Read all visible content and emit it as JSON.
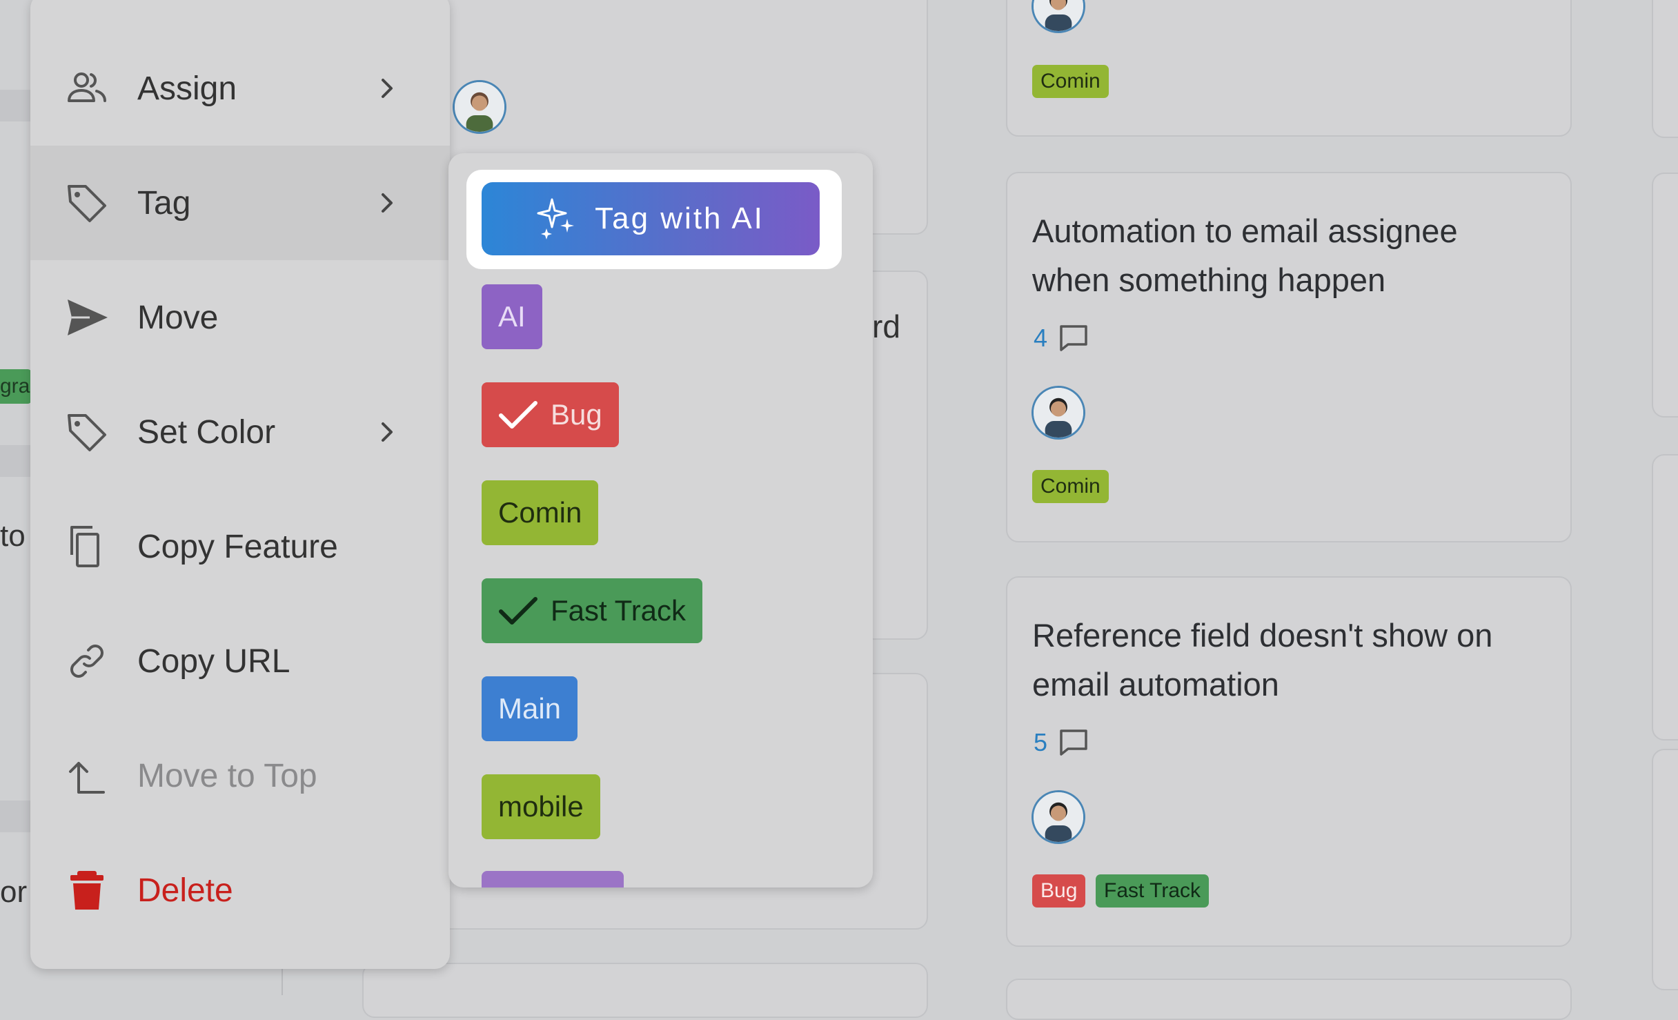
{
  "menu": {
    "items": [
      {
        "label": "Assign",
        "icon": "people-icon",
        "submenu": true
      },
      {
        "label": "Tag",
        "icon": "tag-icon",
        "submenu": true,
        "active": true
      },
      {
        "label": "Move",
        "icon": "send-icon",
        "submenu": false
      },
      {
        "label": "Set Color",
        "icon": "tag-icon",
        "submenu": true
      },
      {
        "label": "Copy Feature",
        "icon": "copy-icon",
        "submenu": false
      },
      {
        "label": "Copy URL",
        "icon": "link-icon",
        "submenu": false
      },
      {
        "label": "Move to Top",
        "icon": "arrow-up-left-icon",
        "submenu": false,
        "disabled": true
      },
      {
        "label": "Delete",
        "icon": "trash-icon",
        "submenu": false,
        "danger": true
      }
    ]
  },
  "tag_panel": {
    "ai_button_label": "Tag with AI",
    "tags": [
      {
        "label": "AI",
        "color": "#8d63c4",
        "text_color": "#e8dcf6",
        "checked": false
      },
      {
        "label": "Bug",
        "color": "#d64b4b",
        "text_color": "#f6dede",
        "checked": true
      },
      {
        "label": "Comin",
        "color": "#93b634",
        "text_color": "#1f2d10",
        "checked": false
      },
      {
        "label": "Fast Track",
        "color": "#4a9a58",
        "text_color": "#102a16",
        "checked": true
      },
      {
        "label": "Main",
        "color": "#3d7fd1",
        "text_color": "#dfeaf8",
        "checked": false
      },
      {
        "label": "mobile",
        "color": "#93b634",
        "text_color": "#1f2d10",
        "checked": false
      }
    ]
  },
  "cards": {
    "top": {
      "tag": "Comin"
    },
    "card1": {
      "title_line1": "Automation to email assignee",
      "title_line2": "when something happen",
      "comments": "4",
      "tag": "Comin"
    },
    "card2": {
      "title_line1": "Reference field doesn't show on",
      "title_line2": "email automation",
      "comments": "5",
      "tags": [
        "Bug",
        "Fast Track"
      ]
    }
  },
  "background_fragments": {
    "left_badge": "gra",
    "left_text1": "to",
    "left_text2": "or",
    "mid_text": "rd"
  },
  "colors": {
    "comin": "#93b634",
    "bug": "#d64b4b",
    "fast_track": "#4a9a58",
    "delete": "#c8201c",
    "comment_count": "#2a7fc0"
  }
}
